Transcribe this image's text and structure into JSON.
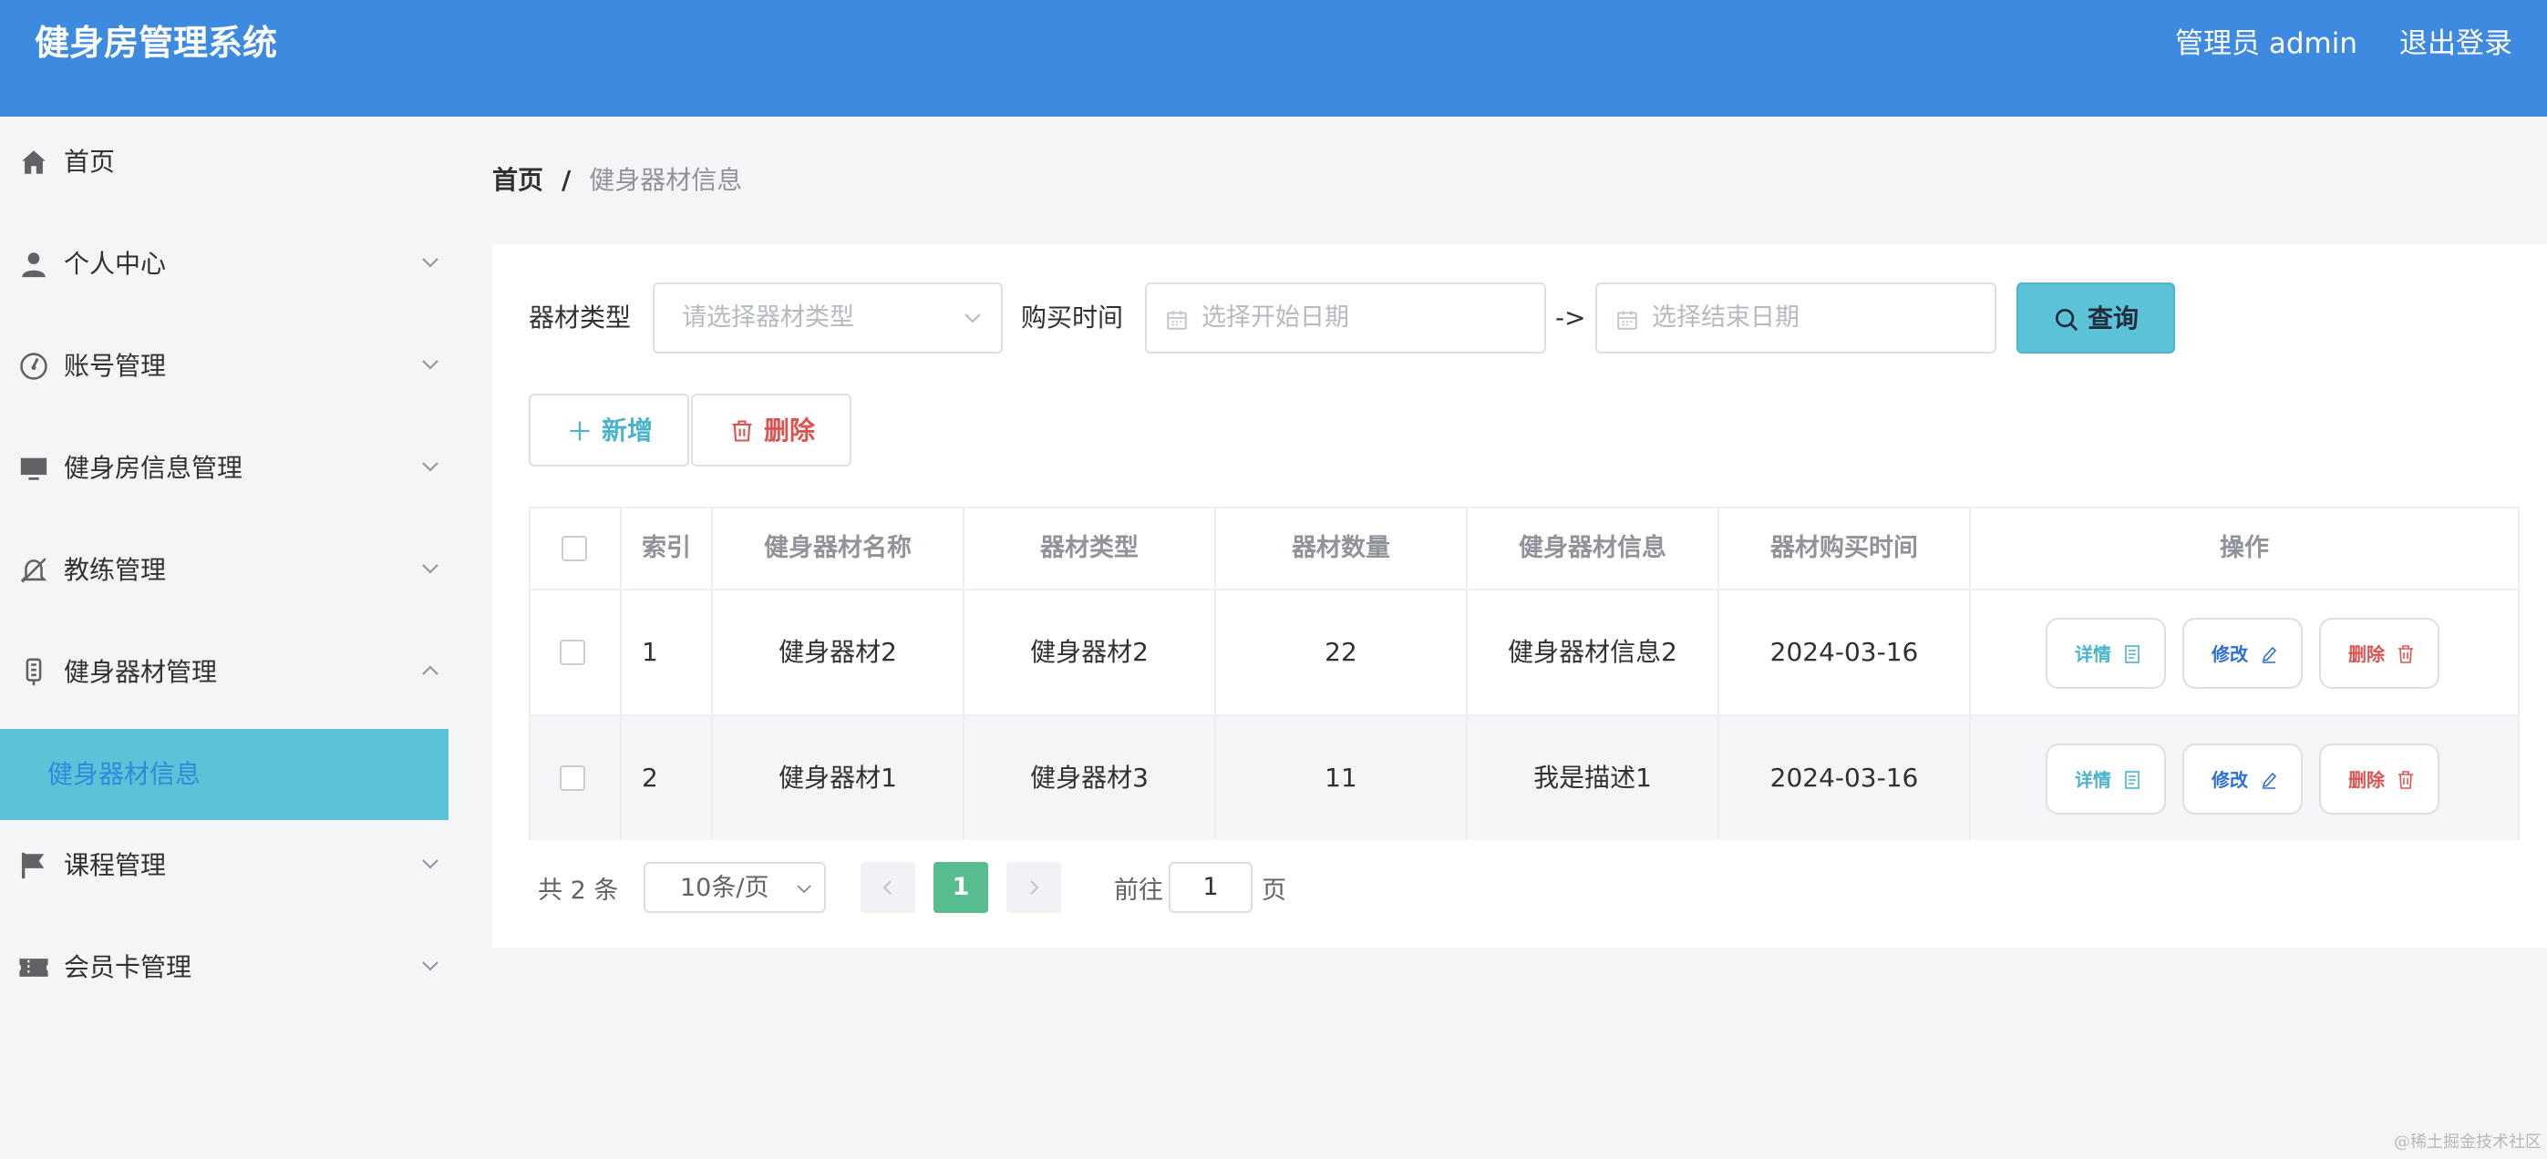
{
  "app": {
    "title": "健身房管理系统"
  },
  "header": {
    "user_label": "管理员 admin",
    "logout_label": "退出登录"
  },
  "sidebar": {
    "items": [
      {
        "label": "首页",
        "icon": "home-icon"
      },
      {
        "label": "个人中心",
        "icon": "user-icon"
      },
      {
        "label": "账号管理",
        "icon": "gauge-icon"
      },
      {
        "label": "健身房信息管理",
        "icon": "monitor-icon"
      },
      {
        "label": "教练管理",
        "icon": "bell-off-icon"
      },
      {
        "label": "健身器材管理",
        "icon": "equipment-icon",
        "expanded": true
      },
      {
        "label": "课程管理",
        "icon": "flag-icon"
      },
      {
        "label": "会员卡管理",
        "icon": "ticket-icon"
      }
    ],
    "sub_active": "健身器材信息"
  },
  "breadcrumb": {
    "home": "首页",
    "separator": "/",
    "current": "健身器材信息"
  },
  "filters": {
    "type_label": "器材类型",
    "type_placeholder": "请选择器材类型",
    "time_label": "购买时间",
    "start_placeholder": "选择开始日期",
    "arrow": "->",
    "end_placeholder": "选择结束日期",
    "query_label": "查询"
  },
  "actions": {
    "add_label": "新增",
    "delete_label": "删除"
  },
  "table": {
    "headers": [
      "索引",
      "健身器材名称",
      "器材类型",
      "器材数量",
      "健身器材信息",
      "器材购买时间",
      "操作"
    ],
    "rows": [
      {
        "index": "1",
        "name": "健身器材2",
        "type": "健身器材2",
        "qty": "22",
        "info": "健身器材信息2",
        "date": "2024-03-16"
      },
      {
        "index": "2",
        "name": "健身器材1",
        "type": "健身器材3",
        "qty": "11",
        "info": "我是描述1",
        "date": "2024-03-16"
      }
    ],
    "ops": {
      "detail": "详情",
      "edit": "修改",
      "delete": "删除"
    }
  },
  "pagination": {
    "total_text": "共 2 条",
    "page_size": "10条/页",
    "current_page": "1",
    "goto_label": "前往",
    "goto_value": "1",
    "page_unit": "页"
  },
  "watermark": "@稀土掘金技术社区",
  "colors": {
    "header_bg": "#3d8ae0",
    "accent_cyan": "#5bc2d8",
    "danger": "#e0524f",
    "edit_blue": "#2d6fd8",
    "pager_active": "#57bd8f"
  }
}
